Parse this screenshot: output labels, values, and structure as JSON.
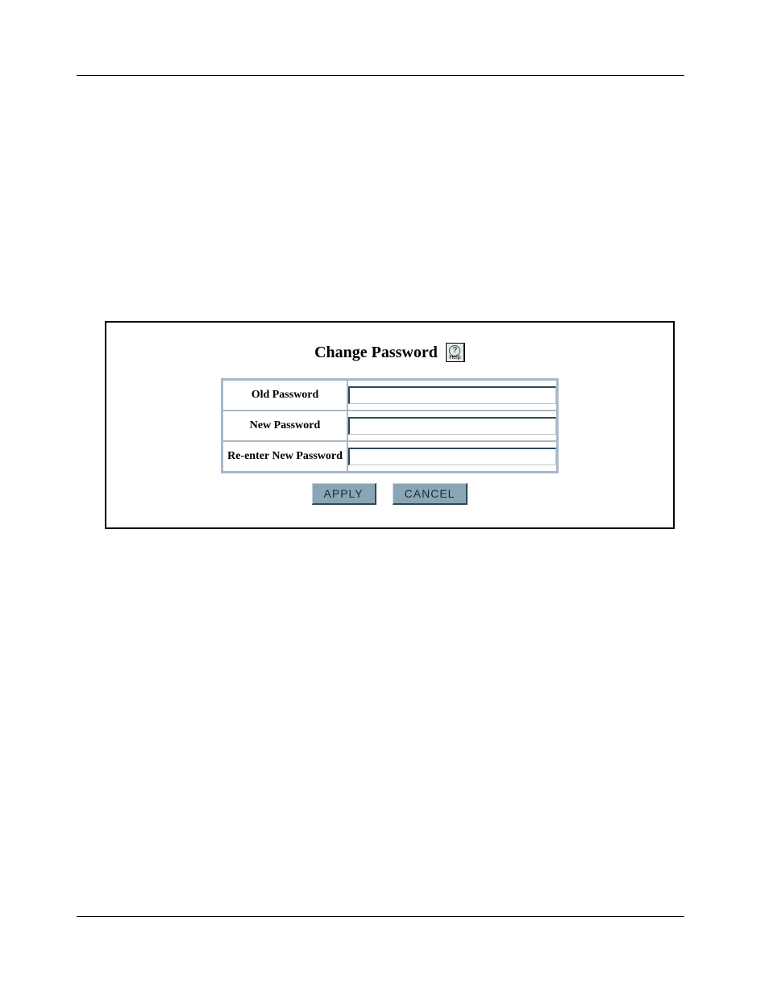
{
  "dialog": {
    "title": "Change Password",
    "help_label": "Help",
    "fields": {
      "old_password": {
        "label": "Old Password",
        "value": ""
      },
      "new_password": {
        "label": "New Password",
        "value": ""
      },
      "reenter_password": {
        "label": "Re-enter New Password",
        "value": ""
      }
    },
    "buttons": {
      "apply": "APPLY",
      "cancel": "CANCEL"
    }
  }
}
